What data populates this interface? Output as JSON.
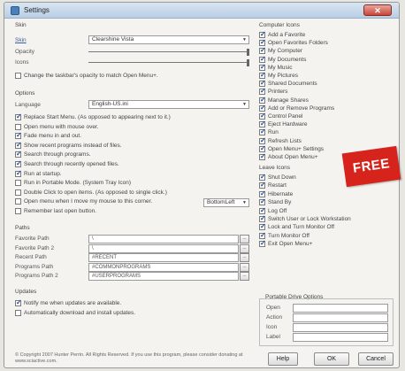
{
  "window": {
    "title": "Settings"
  },
  "skin": {
    "section": "Skin",
    "skin_label": "Skin",
    "skin_value": "Clearshine Vista",
    "opacity_label": "Opacity",
    "icons_label": "Icons",
    "opacity_level": 1.0,
    "icons_level": 1.0,
    "taskbar_opacity": {
      "label": "Change the taskbar's opacity to match Open Menu+.",
      "checked": false
    }
  },
  "options": {
    "section": "Options",
    "language_label": "Language",
    "language_value": "English-US.ini",
    "checks": [
      {
        "label": "Replace Start Menu. (As opposed to appearing next to it.)",
        "checked": true
      },
      {
        "label": "Open menu with mouse over.",
        "checked": false
      },
      {
        "label": "Fade menu in and out.",
        "checked": true
      },
      {
        "label": "Show recent programs instead of files.",
        "checked": true
      },
      {
        "label": "Search through programs.",
        "checked": true
      },
      {
        "label": "Search through recently opened files.",
        "checked": true
      },
      {
        "label": "Run at startup.",
        "checked": true
      },
      {
        "label": "Run in Portable Mode. (System Tray Icon)",
        "checked": false
      },
      {
        "label": "Double Click to open items. (As opposed to single click.)",
        "checked": false
      },
      {
        "label": "Open menu when I move my mouse to this corner.",
        "checked": false
      },
      {
        "label": "Remember last open button.",
        "checked": false
      }
    ],
    "corner_value": "BottomLeft"
  },
  "paths": {
    "section": "Paths",
    "rows": [
      {
        "label": "Favorite Path",
        "value": "\\"
      },
      {
        "label": "Favorite Path 2",
        "value": "\\"
      },
      {
        "label": "Recent Path",
        "value": "#RECENT"
      },
      {
        "label": "Programs Path",
        "value": "#COMMONPROGRAMS"
      },
      {
        "label": "Programs Path 2",
        "value": "#USERPROGRAMS"
      }
    ],
    "browse_label": "..."
  },
  "updates": {
    "section": "Updates",
    "checks": [
      {
        "label": "Notify me when updates are available.",
        "checked": true
      },
      {
        "label": "Automatically download and install updates.",
        "checked": false
      }
    ]
  },
  "computer_icons": {
    "section": "Computer Icons",
    "items": [
      {
        "label": "Add a Favorite",
        "checked": true
      },
      {
        "label": "Open Favorites Folders",
        "checked": true
      },
      {
        "label": "My Computer",
        "checked": true
      },
      {
        "label": "My Documents",
        "checked": true
      },
      {
        "label": "My Music",
        "checked": true
      },
      {
        "label": "My Pictures",
        "checked": true
      },
      {
        "label": "Shared Documents",
        "checked": true
      },
      {
        "label": "Printers",
        "checked": true
      },
      {
        "label": "Manage Shares",
        "checked": true
      },
      {
        "label": "Add or Remove Programs",
        "checked": true
      },
      {
        "label": "Control Panel",
        "checked": true
      },
      {
        "label": "Eject Hardware",
        "checked": true
      },
      {
        "label": "Run",
        "checked": true
      },
      {
        "label": "Refresh Lists",
        "checked": true
      },
      {
        "label": "Open Menu+ Settings",
        "checked": true
      },
      {
        "label": "About Open Menu+",
        "checked": true
      }
    ]
  },
  "leave_icons": {
    "section": "Leave Icons",
    "items": [
      {
        "label": "Shut Down",
        "checked": true
      },
      {
        "label": "Restart",
        "checked": true
      },
      {
        "label": "Hibernate",
        "checked": true
      },
      {
        "label": "Stand By",
        "checked": true
      },
      {
        "label": "Log Off",
        "checked": true
      },
      {
        "label": "Switch User or Lock Workstation",
        "checked": true
      },
      {
        "label": "Lock and Turn Monitor Off",
        "checked": true
      },
      {
        "label": "Turn Monitor Off",
        "checked": true
      },
      {
        "label": "Exit Open Menu+",
        "checked": true
      }
    ]
  },
  "portable": {
    "section": "Portable Drive Options",
    "rows": [
      {
        "label": "Open",
        "value": ""
      },
      {
        "label": "Action",
        "value": ""
      },
      {
        "label": "Icon",
        "value": ""
      },
      {
        "label": "Label",
        "value": ""
      }
    ]
  },
  "footer": {
    "copyright": "© Copyright 2007 Hunter Perrin. All Rights Reserved. If you use this program, please consider donating at www.sciactive.com.",
    "help": "Help",
    "ok": "OK",
    "cancel": "Cancel"
  },
  "badge": {
    "text": "FREE",
    "color": "#d6231c"
  },
  "colors": {
    "check": "#1c4e9a",
    "link": "#3a5fa0",
    "titlebar": "#c5d7ea"
  }
}
